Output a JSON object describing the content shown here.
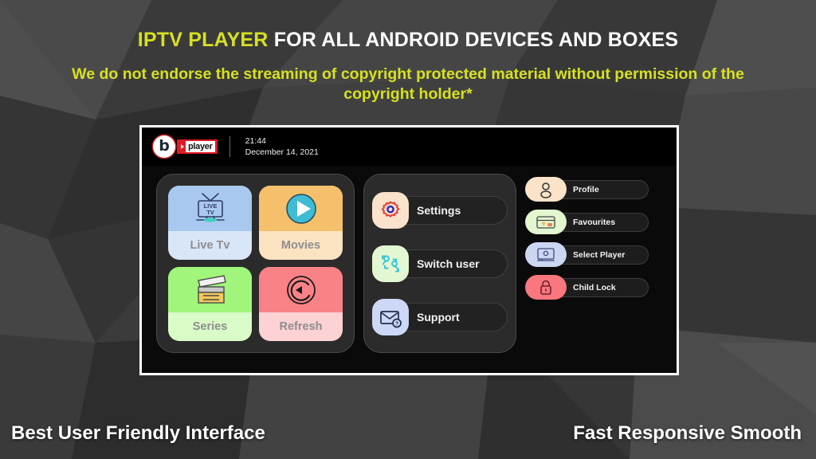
{
  "headline": {
    "brand": "IPTV PLAYER",
    "rest": " FOR ALL ANDROID DEVICES AND BOXES",
    "brand_color": "#d7e021",
    "rest_color": "#ffffff"
  },
  "subline": {
    "text": "We do not endorse the streaming of copyright protected material without permission of the copyright holder*",
    "color": "#d7e021"
  },
  "app": {
    "topbar": {
      "logo_letter": "b",
      "logo_badge_text": "player",
      "time": "21:44",
      "date": "December 14, 2021"
    },
    "tiles": [
      {
        "label": "Live Tv",
        "icon": "live-tv-icon",
        "icon_bg": "#a9c8f0",
        "label_bg": "#d9e6f8",
        "inner_text": "LIVE TV"
      },
      {
        "label": "Movies",
        "icon": "play-circle-icon",
        "icon_bg": "#f6bf6b",
        "label_bg": "#fbe3c2"
      },
      {
        "label": "Series",
        "icon": "clapperboard-icon",
        "icon_bg": "#a0f57a",
        "label_bg": "#d9fbc8"
      },
      {
        "label": "Refresh",
        "icon": "refresh-circle-icon",
        "icon_bg": "#f98287",
        "label_bg": "#fcd2d4"
      }
    ],
    "menu": [
      {
        "label": "Settings",
        "icon": "gear-icon",
        "badge_bg": "#fbe2cc"
      },
      {
        "label": "Switch user",
        "icon": "switch-user-icon",
        "badge_bg": "#e3f7d2"
      },
      {
        "label": "Support",
        "icon": "envelope-help-icon",
        "badge_bg": "#ccd8f5"
      }
    ],
    "side": [
      {
        "label": "Profile",
        "icon": "person-icon",
        "badge_bg": "#fae3c8"
      },
      {
        "label": "Favourites",
        "icon": "card-icon",
        "badge_bg": "#e2f6d0"
      },
      {
        "label": "Select Player",
        "icon": "monitor-icon",
        "badge_bg": "#ccd6f3"
      },
      {
        "label": "Child Lock",
        "icon": "padlock-icon",
        "badge_bg": "#f9777d"
      }
    ]
  },
  "footer": {
    "left": "Best User Friendly Interface",
    "right": "Fast Responsive Smooth"
  }
}
